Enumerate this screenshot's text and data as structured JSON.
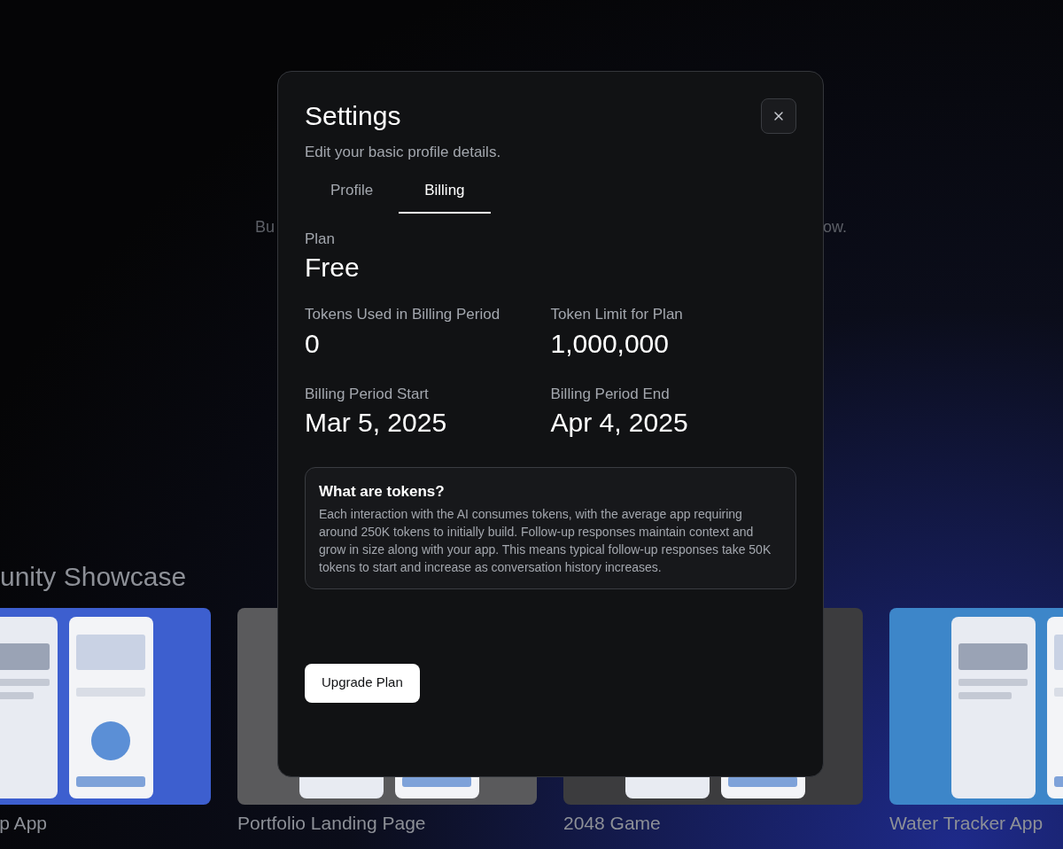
{
  "background": {
    "hero_fragments": [
      "Bu",
      "ow."
    ],
    "showcase_heading": "unity Showcase",
    "showcase": [
      {
        "title": "p App"
      },
      {
        "title": "Portfolio Landing Page"
      },
      {
        "title": "2048 Game"
      },
      {
        "title": "Water Tracker App"
      }
    ]
  },
  "dialog": {
    "title": "Settings",
    "subtitle": "Edit your basic profile details.",
    "tabs": [
      {
        "label": "Profile",
        "selected": false
      },
      {
        "label": "Billing",
        "selected": true
      }
    ],
    "plan": {
      "label": "Plan",
      "value": "Free"
    },
    "stats": [
      {
        "label": "Tokens Used in Billing Period",
        "value": "0"
      },
      {
        "label": "Token Limit for Plan",
        "value": "1,000,000"
      },
      {
        "label": "Billing Period Start",
        "value": "Mar 5, 2025"
      },
      {
        "label": "Billing Period End",
        "value": "Apr 4, 2025"
      }
    ],
    "info": {
      "title": "What are tokens?",
      "body": "Each interaction with the AI consumes tokens, with the average app requiring around 250K tokens to initially build. Follow-up responses maintain context and grow in size along with your app. This means typical follow-up responses take 50K tokens to start and increase as conversation history increases."
    },
    "primary_button": "Upgrade Plan"
  }
}
